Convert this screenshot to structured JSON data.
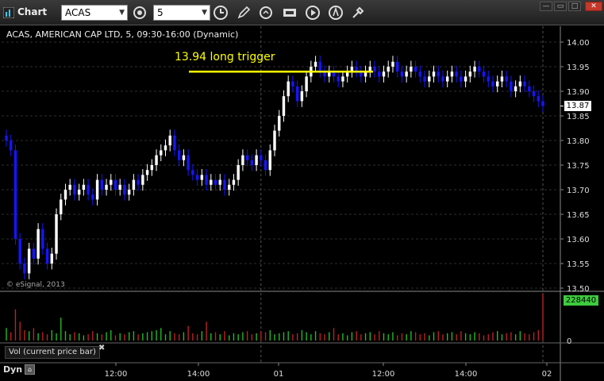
{
  "window": {
    "title": "Chart",
    "symbol_value": "ACAS",
    "interval_value": "5",
    "controls": [
      "minimize",
      "maximize",
      "close"
    ]
  },
  "toolbar_icons": [
    "settings-cog-icon",
    "clock-icon",
    "pencil-icon",
    "refresh-icon",
    "cursor-icon",
    "play-icon",
    "alert-icon",
    "tools-icon"
  ],
  "chart": {
    "symbol_line": "ACAS, AMERICAN CAP LTD, 5, 09:30-16:00 (Dynamic)",
    "annotation": "13.94 long trigger",
    "watermark": "© eSignal, 2013",
    "current_price": "13.87",
    "volume_current": "228440",
    "volume_zero": "0",
    "volume_panel_label": "Vol (current price bar)",
    "footer_label": "Dyn",
    "x_labels": [
      "12:00",
      "14:00",
      "01",
      "12:00",
      "14:00",
      "02"
    ],
    "y_labels": [
      "14.00",
      "13.95",
      "13.90",
      "13.85",
      "13.80",
      "13.75",
      "13.70",
      "13.65",
      "13.60",
      "13.55",
      "13.50"
    ]
  },
  "chart_data": {
    "type": "candlestick",
    "ylim": [
      13.5,
      14.0
    ],
    "trigger_level": 13.94,
    "colors": {
      "up": "#ffffff",
      "down": "#1515ff",
      "trigger": "#ffff00",
      "vol_up": "#22bb22",
      "vol_down": "#bb2222"
    },
    "closes": [
      13.8,
      13.78,
      13.6,
      13.55,
      13.53,
      13.58,
      13.56,
      13.62,
      13.58,
      13.55,
      13.57,
      13.65,
      13.68,
      13.7,
      13.71,
      13.69,
      13.7,
      13.71,
      13.69,
      13.68,
      13.72,
      13.7,
      13.71,
      13.72,
      13.7,
      13.71,
      13.69,
      13.7,
      13.72,
      13.71,
      13.73,
      13.74,
      13.75,
      13.77,
      13.78,
      13.79,
      13.81,
      13.78,
      13.76,
      13.77,
      13.74,
      13.73,
      13.72,
      13.73,
      13.71,
      13.72,
      13.71,
      13.72,
      13.7,
      13.71,
      13.72,
      13.75,
      13.77,
      13.76,
      13.75,
      13.77,
      13.76,
      13.74,
      13.78,
      13.82,
      13.85,
      13.89,
      13.92,
      13.91,
      13.88,
      13.9,
      13.93,
      13.95,
      13.96,
      13.94,
      13.93,
      13.94,
      13.93,
      13.92,
      13.93,
      13.94,
      13.95,
      13.94,
      13.93,
      13.94,
      13.95,
      13.94,
      13.93,
      13.94,
      13.95,
      13.96,
      13.94,
      13.93,
      13.94,
      13.95,
      13.94,
      13.93,
      13.92,
      13.93,
      13.94,
      13.93,
      13.92,
      13.93,
      13.94,
      13.93,
      13.92,
      13.93,
      13.94,
      13.95,
      13.94,
      13.93,
      13.92,
      13.91,
      13.92,
      13.93,
      13.92,
      13.9,
      13.91,
      13.92,
      13.91,
      13.9,
      13.89,
      13.88,
      13.87
    ],
    "volumes": [
      12,
      8,
      30,
      18,
      10,
      9,
      12,
      7,
      8,
      6,
      10,
      7,
      22,
      9,
      6,
      8,
      7,
      5,
      6,
      9,
      7,
      6,
      8,
      10,
      5,
      7,
      6,
      8,
      9,
      6,
      7,
      8,
      9,
      10,
      12,
      6,
      9,
      7,
      6,
      8,
      14,
      7,
      6,
      9,
      18,
      7,
      8,
      6,
      9,
      5,
      7,
      6,
      8,
      9,
      6,
      7,
      9,
      8,
      10,
      6,
      7,
      8,
      9,
      6,
      7,
      10,
      8,
      6,
      9,
      7,
      6,
      8,
      12,
      6,
      7,
      5,
      8,
      9,
      6,
      7,
      8,
      6,
      9,
      7,
      6,
      8,
      5,
      7,
      6,
      9,
      8,
      6,
      7,
      5,
      8,
      9,
      6,
      7,
      8,
      6,
      9,
      7,
      6,
      8,
      7,
      5,
      6,
      8,
      9,
      6,
      7,
      8,
      6,
      9,
      7,
      6,
      8,
      10,
      45
    ]
  }
}
